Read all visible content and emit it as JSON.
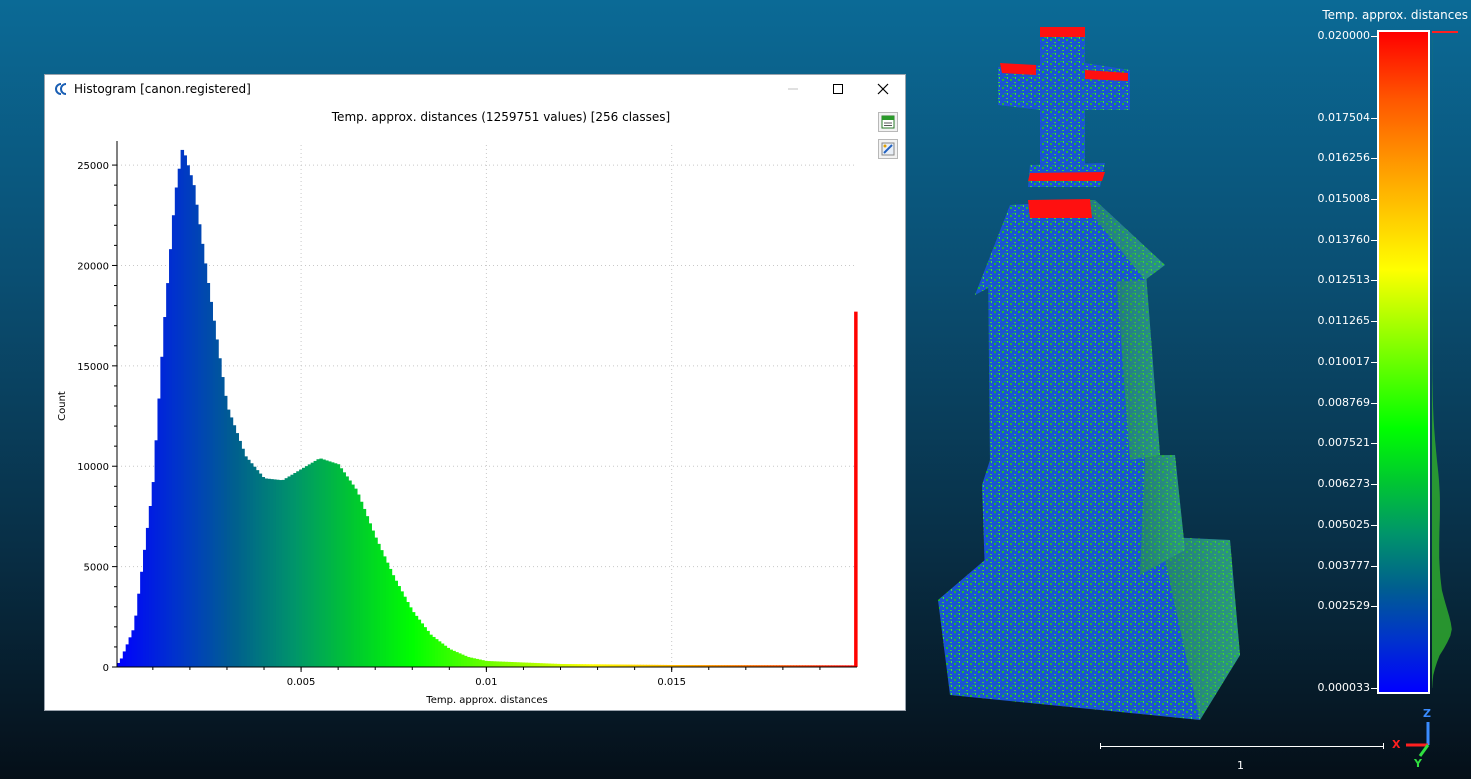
{
  "window": {
    "title": "Histogram [canon.registered]"
  },
  "chart_data": {
    "type": "bar",
    "title": "Temp. approx. distances (1259751 values)  [256 classes]",
    "xlabel": "Temp. approx. distances",
    "ylabel": "Count",
    "xlim": [
      3.3e-05,
      0.02
    ],
    "ylim": [
      0,
      26000
    ],
    "x_ticks": [
      "0.005",
      "0.01",
      "0.015"
    ],
    "y_ticks": [
      "0",
      "5000",
      "10000",
      "15000",
      "20000",
      "25000"
    ],
    "grid": true,
    "classes": 256,
    "peaks": [
      {
        "x": 0.0001,
        "y": 200
      },
      {
        "x": 0.0005,
        "y": 2000
      },
      {
        "x": 0.001,
        "y": 9000
      },
      {
        "x": 0.0013,
        "y": 17000
      },
      {
        "x": 0.0016,
        "y": 23500
      },
      {
        "x": 0.0018,
        "y": 25900
      },
      {
        "x": 0.0021,
        "y": 24000
      },
      {
        "x": 0.0025,
        "y": 19000
      },
      {
        "x": 0.003,
        "y": 13000
      },
      {
        "x": 0.0035,
        "y": 10500
      },
      {
        "x": 0.004,
        "y": 9400
      },
      {
        "x": 0.0045,
        "y": 9300
      },
      {
        "x": 0.0055,
        "y": 10400
      },
      {
        "x": 0.006,
        "y": 10100
      },
      {
        "x": 0.0065,
        "y": 8800
      },
      {
        "x": 0.007,
        "y": 6500
      },
      {
        "x": 0.0075,
        "y": 4500
      },
      {
        "x": 0.008,
        "y": 2800
      },
      {
        "x": 0.0085,
        "y": 1600
      },
      {
        "x": 0.009,
        "y": 900
      },
      {
        "x": 0.0095,
        "y": 500
      },
      {
        "x": 0.01,
        "y": 300
      },
      {
        "x": 0.012,
        "y": 150
      },
      {
        "x": 0.015,
        "y": 100
      },
      {
        "x": 0.0199,
        "y": 80
      }
    ],
    "last_bin": {
      "x": 0.02,
      "y": 17700
    }
  },
  "color_scale": {
    "title": "Temp. approx. distances",
    "labels": [
      "0.020000",
      "0.017504",
      "0.016256",
      "0.015008",
      "0.013760",
      "0.012513",
      "0.011265",
      "0.010017",
      "0.008769",
      "0.007521",
      "0.006273",
      "0.005025",
      "0.003777",
      "0.002529",
      "0.000033"
    ],
    "min": 3.3e-05,
    "max": 0.02
  },
  "view": {
    "scale_label": "1",
    "axes": {
      "x": "X",
      "y": "Y",
      "z": "Z"
    },
    "colors": {
      "x": "#ff2020",
      "y": "#30e040",
      "z": "#3a8cff"
    }
  }
}
